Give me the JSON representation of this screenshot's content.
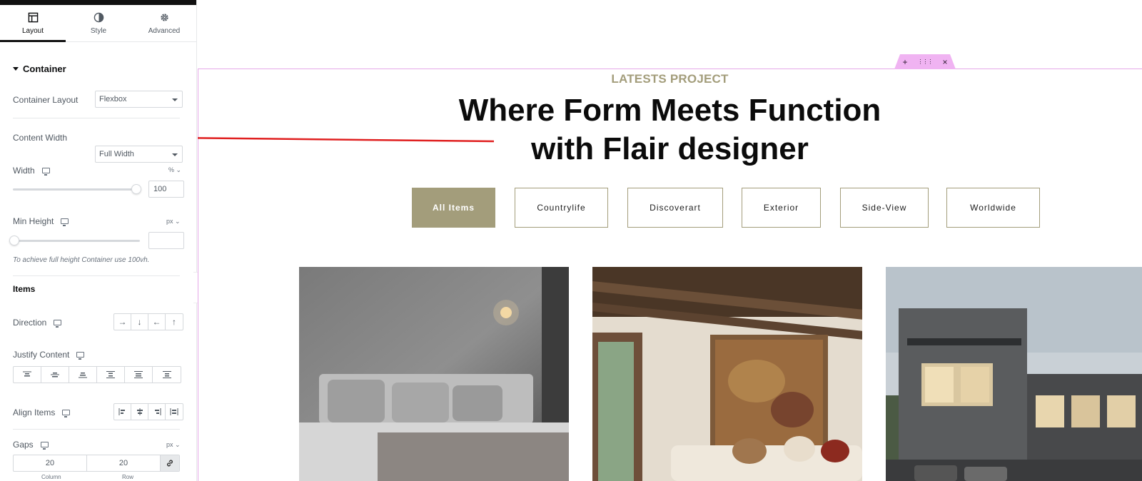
{
  "panel": {
    "tabs": [
      {
        "label": "Layout",
        "icon": "layout-icon"
      },
      {
        "label": "Style",
        "icon": "half-circle-icon"
      },
      {
        "label": "Advanced",
        "icon": "gear-icon"
      }
    ],
    "section_title": "Container",
    "container_layout": {
      "label": "Container Layout",
      "value": "Flexbox"
    },
    "content_width": {
      "label": "Content Width",
      "value": "Full Width"
    },
    "width": {
      "label": "Width",
      "unit": "%",
      "value": "100",
      "slider_fraction": 1.0
    },
    "min_height": {
      "label": "Min Height",
      "unit": "px",
      "value": "",
      "slider_fraction": 0.0
    },
    "hint": "To achieve full height Container use 100vh.",
    "items_heading": "Items",
    "direction": {
      "label": "Direction",
      "options": [
        "→",
        "↓",
        "←",
        "↑"
      ]
    },
    "justify_content": {
      "label": "Justify Content"
    },
    "align_items": {
      "label": "Align Items"
    },
    "gaps": {
      "label": "Gaps",
      "unit": "px",
      "column": "20",
      "row": "20",
      "column_label": "Column",
      "row_label": "Row"
    }
  },
  "canvas": {
    "handle_icons": [
      "+",
      "⋮⋮⋮",
      "×"
    ],
    "eyebrow": "LATESTS PROJECT",
    "headline_line1": "Where Form Meets Function",
    "headline_line2": "with Flair designer",
    "filters": [
      "All Items",
      "Countrylife",
      "Discoverart",
      "Exterior",
      "Side-View",
      "Worldwide"
    ],
    "active_filter": "All Items",
    "cards": [
      "bedroom-photo",
      "living-room-photo",
      "modern-house-photo"
    ]
  },
  "colors": {
    "accent": "#a39d7b",
    "outline": "#e5a8e8",
    "arrow": "#e02020"
  }
}
